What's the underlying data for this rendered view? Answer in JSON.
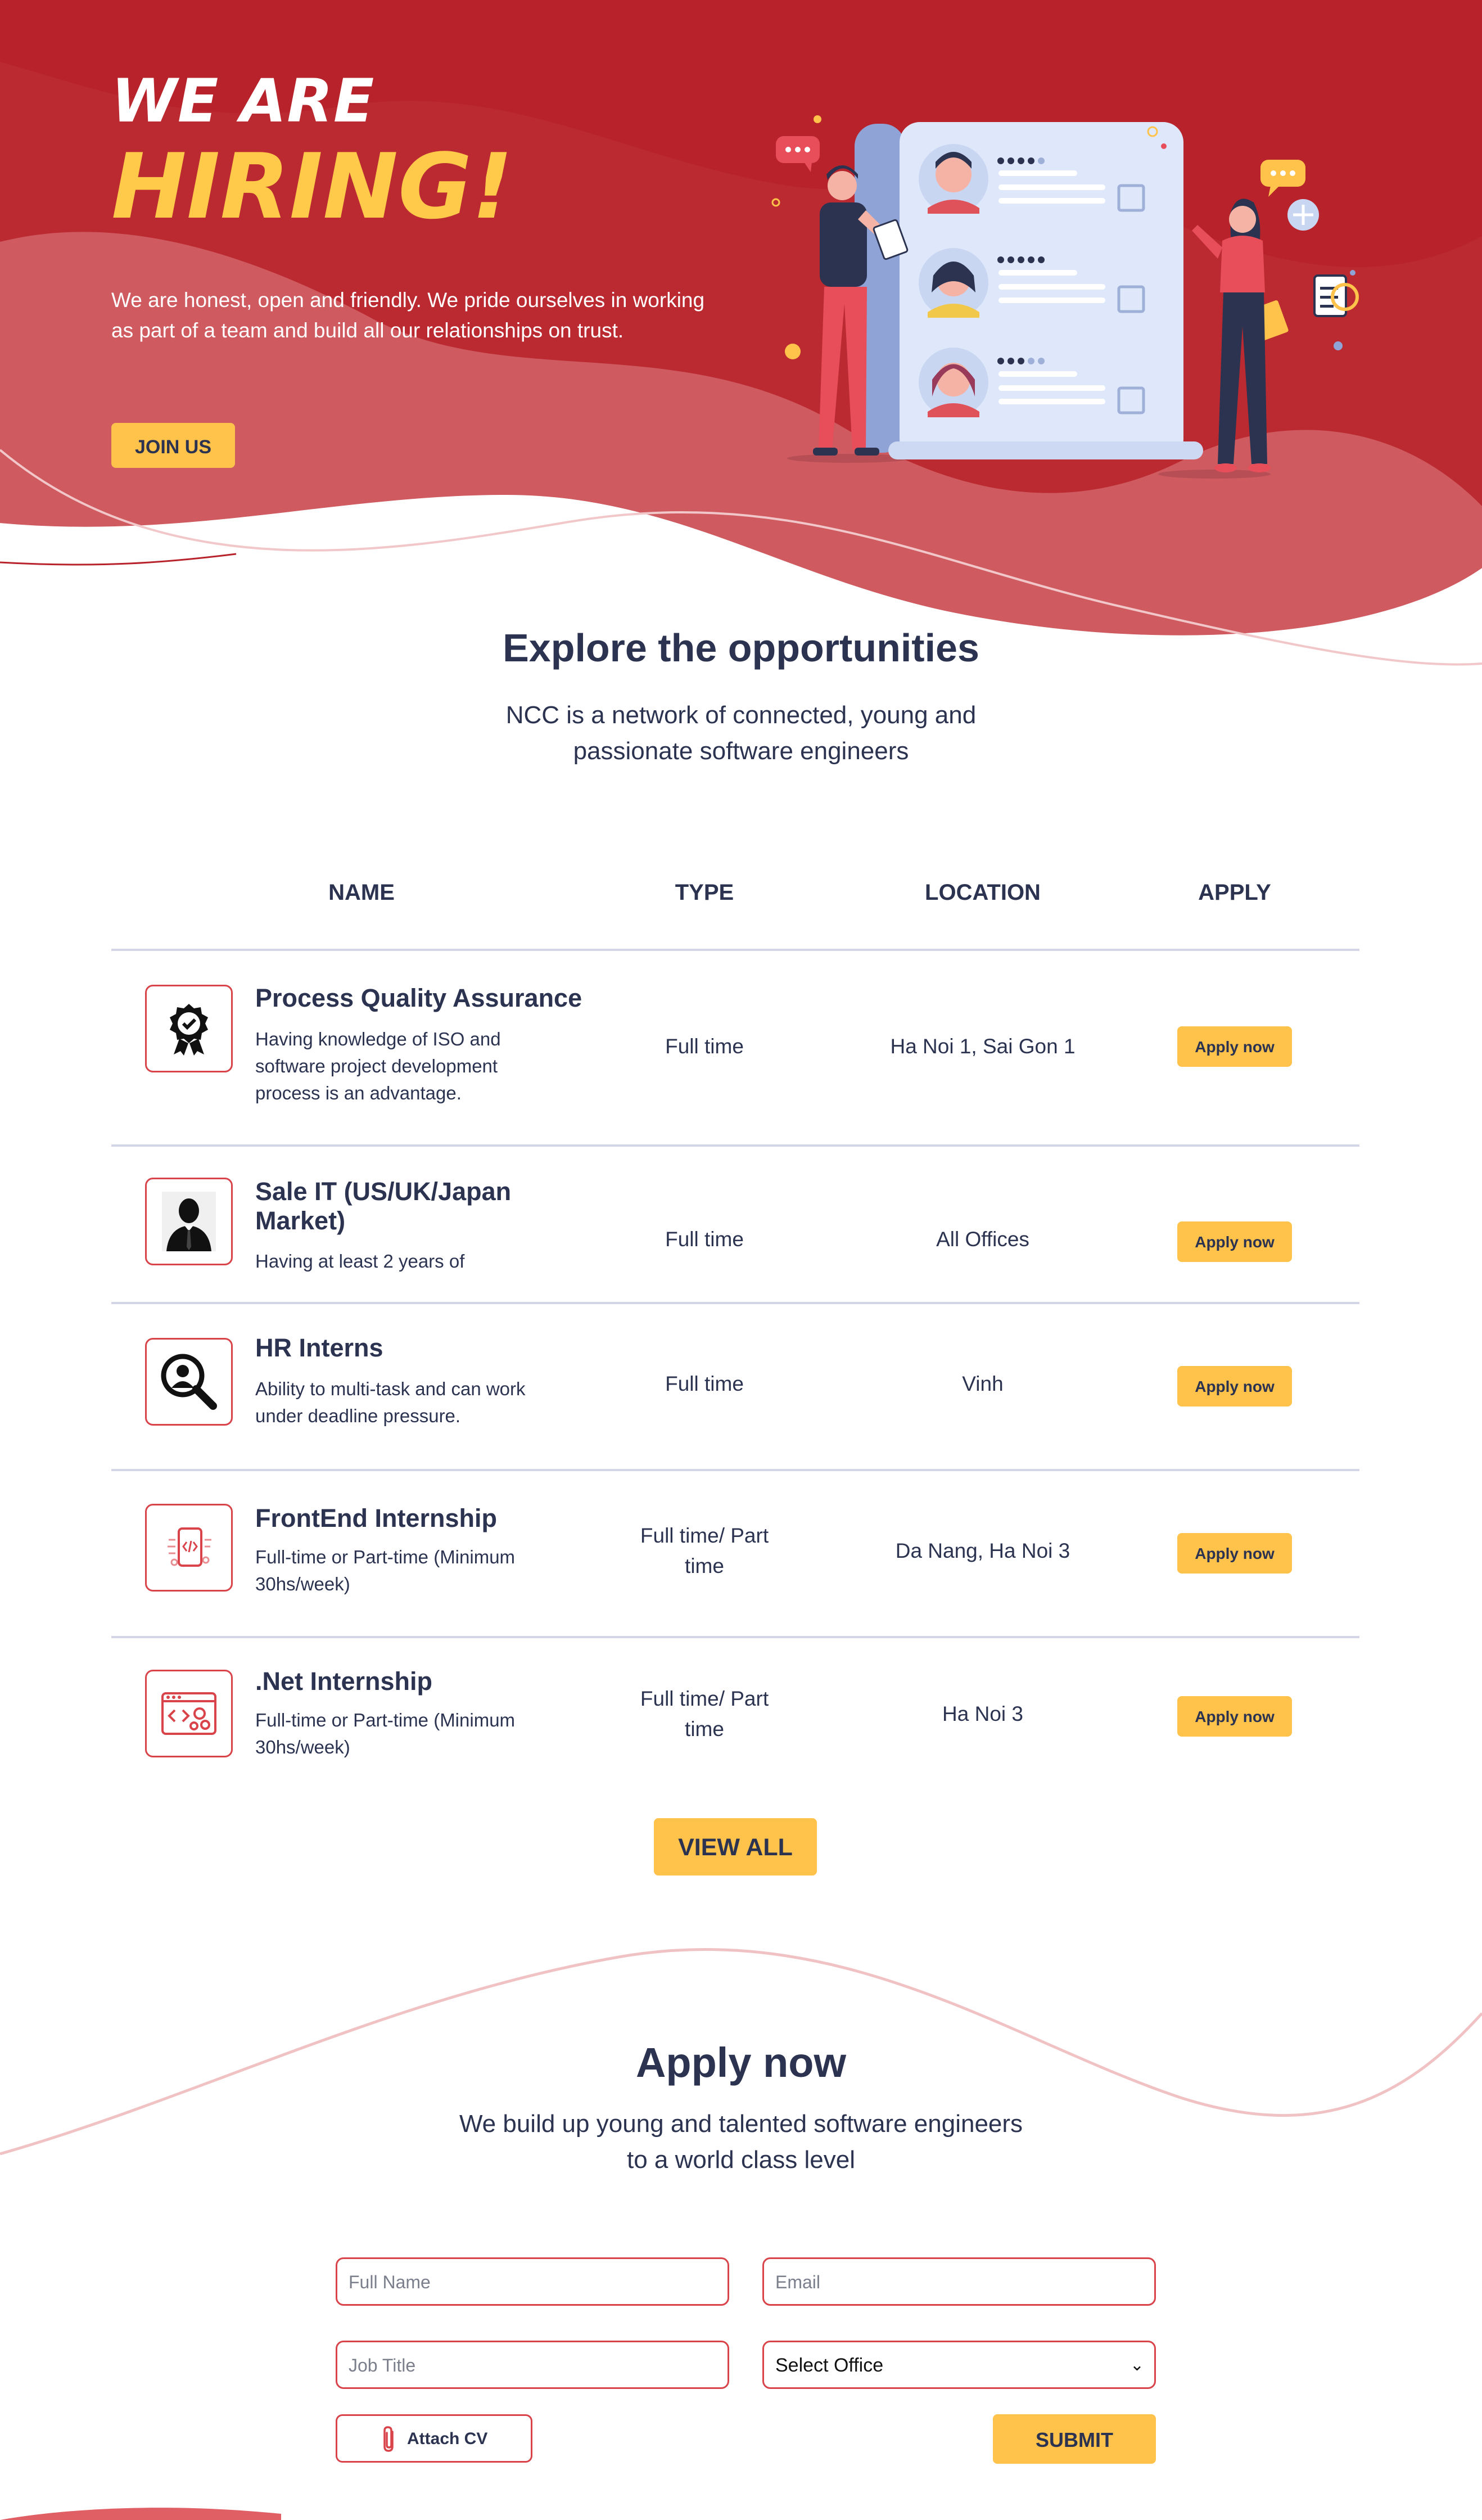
{
  "colors": {
    "hero_red": "#c0272d",
    "accent_yellow": "#ffc24a",
    "text_navy": "#2b3350",
    "border_red": "#d9434a"
  },
  "hero": {
    "line1": "WE ARE",
    "line2": "HIRING!",
    "description": "We are honest, open and friendly. We pride ourselves in working as part of a team and build all our relationships on trust.",
    "cta": "JOIN US"
  },
  "explore": {
    "title": "Explore the opportunities",
    "subtitle_line1": "NCC is a network of connected, young and",
    "subtitle_line2": "passionate software engineers"
  },
  "table": {
    "headers": [
      "NAME",
      "TYPE",
      "LOCATION",
      "APPLY"
    ],
    "rows": [
      {
        "icon": "award-ribbon-icon",
        "title": "Process Quality Assurance",
        "description": [
          "Having knowledge of ISO and",
          "software project development",
          "process is an advantage."
        ],
        "type": [
          "Full time"
        ],
        "location": "Ha Noi 1, Sai Gon 1",
        "apply": "Apply now"
      },
      {
        "icon": "businessman-icon",
        "title": [
          "Sale IT (US/UK/Japan",
          "Market)"
        ],
        "description": [
          "Having at least 2 years of"
        ],
        "type": [
          "Full time"
        ],
        "location": "All Offices",
        "apply": "Apply now"
      },
      {
        "icon": "user-search-icon",
        "title": "HR Interns",
        "description": [
          "Ability to multi-task and can work",
          "under deadline pressure."
        ],
        "type": [
          "Full time"
        ],
        "location": "Vinh",
        "apply": "Apply now"
      },
      {
        "icon": "code-device-icon",
        "title": "FrontEnd Internship",
        "description": [
          "Full-time or Part-time (Minimum",
          "30hs/week)"
        ],
        "type": [
          "Full time/ Part",
          "time"
        ],
        "location": "Da Nang, Ha Noi 3",
        "apply": "Apply now"
      },
      {
        "icon": "code-window-gears-icon",
        "title": ".Net Internship",
        "description": [
          "Full-time or Part-time (Minimum",
          "30hs/week)"
        ],
        "type": [
          "Full time/ Part",
          "time"
        ],
        "location": "Ha Noi 3",
        "apply": "Apply now"
      }
    ],
    "view_all": "VIEW ALL"
  },
  "apply_section": {
    "title": "Apply now",
    "subtitle_line1": "We build up young and talented software engineers",
    "subtitle_line2": "to a world class level",
    "form": {
      "full_name_placeholder": "Full Name",
      "email_placeholder": "Email",
      "job_title_placeholder": "Job Title",
      "office_selected": "Select Office",
      "attach_label": "Attach CV",
      "submit_label": "SUBMIT"
    }
  }
}
